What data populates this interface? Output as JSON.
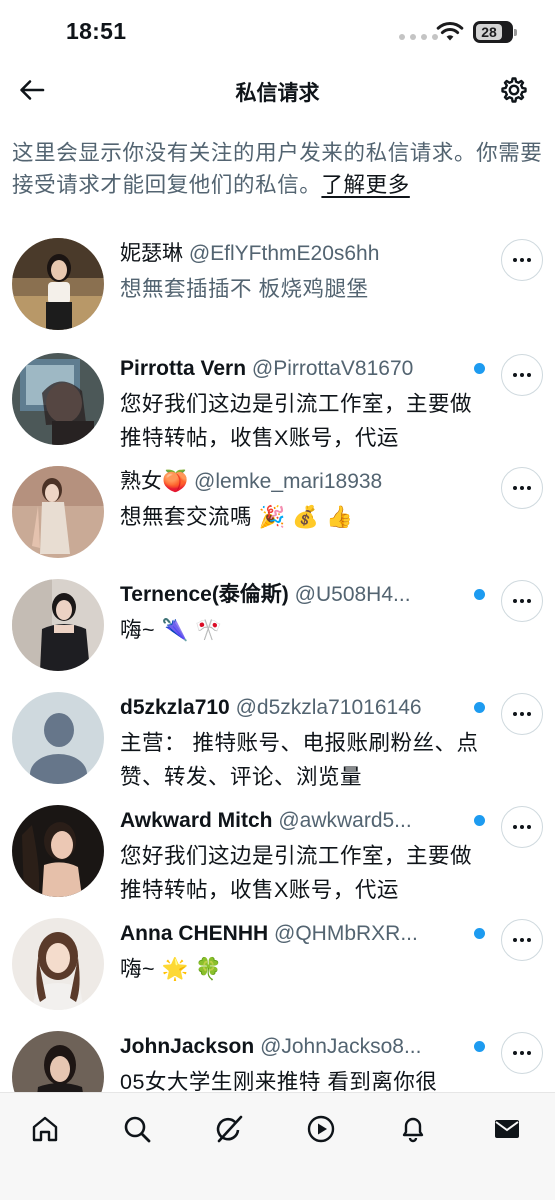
{
  "status_bar": {
    "time": "18:51",
    "battery": "28"
  },
  "header": {
    "title": "私信请求"
  },
  "intro": {
    "text": "这里会显示你没有关注的用户发来的私信请求。你需要接受请求才能回复他们的私信。",
    "link": "了解更多"
  },
  "requests": [
    {
      "name": "妮瑟琳",
      "handle": "@EflYFthmE20s6hh",
      "message": "想無套插插不 板烧鸡腿堡",
      "unread": false
    },
    {
      "name": "Pirrotta Vern",
      "handle": "@PirrottaV81670",
      "message": "您好我们这边是引流工作室，主要做推特转帖，收售X账号，代运",
      "unread": true
    },
    {
      "name": "熟女🍑",
      "handle": "@lemke_mari18938",
      "message": "想無套交流嗎 🎉 💰 👍",
      "unread": false
    },
    {
      "name": "Ternence(泰倫斯)",
      "handle": "@U508H4...",
      "message": "嗨~ 🌂 🎌",
      "unread": true
    },
    {
      "name": "d5zkzla710",
      "handle": "@d5zkzla71016146",
      "message": "主营： 推特账号、电报账刷粉丝、点赞、转发、评论、浏览量",
      "unread": true
    },
    {
      "name": "Awkward Mitch",
      "handle": "@awkward5...",
      "message": "您好我们这边是引流工作室，主要做推特转帖，收售X账号，代运",
      "unread": true
    },
    {
      "name": "Anna CHENHH",
      "handle": "@QHMbRXR...",
      "message": "嗨~ 🌟 🍀",
      "unread": true
    },
    {
      "name": "JohnJackson",
      "handle": "@JohnJackso8...",
      "message": "05女大学生刚来推特 看到离你很",
      "unread": true
    }
  ],
  "colors": {
    "accent": "#1d9bf0",
    "text": "#0f1419",
    "muted": "#536471"
  },
  "icons": {
    "back": "arrow-left-icon",
    "settings": "gear-icon",
    "more": "more-dots-icon",
    "nav": [
      "home-icon",
      "search-icon",
      "grok-icon",
      "video-icon",
      "bell-icon",
      "mail-icon"
    ]
  }
}
